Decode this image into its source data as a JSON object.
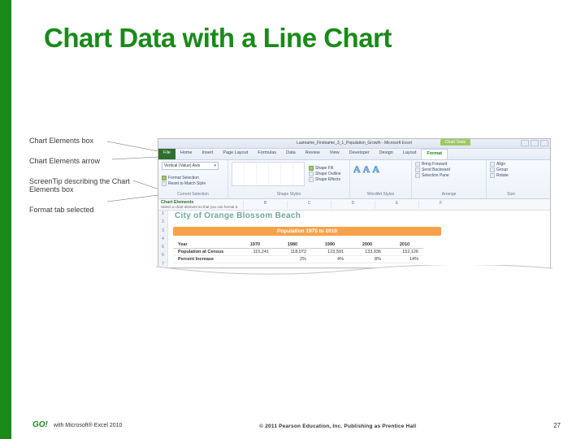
{
  "slide": {
    "title": "Chart Data with a Line Chart",
    "callouts": {
      "c1": "Chart Elements box",
      "c2": "Chart Elements arrow",
      "c3": "ScreenTip describing the Chart Elements box",
      "c4": "Format tab selected"
    }
  },
  "excel": {
    "titlebar": "Lastname_Firstname_3_1_Population_Growth - Microsoft Excel",
    "chart_tools": "Chart Tools",
    "file_tab": "File",
    "tabs": [
      "Home",
      "Insert",
      "Page Layout",
      "Formulas",
      "Data",
      "Review",
      "View",
      "Developer",
      "Design",
      "Layout",
      "Format"
    ],
    "selected_tab": "Format",
    "element_box_value": "Vertical (Value) Axis",
    "format_selection": "Format Selection",
    "reset_style": "Reset to Match Style",
    "group_current": "Current Selection",
    "group_shape_styles": "Shape Styles",
    "group_wordart": "WordArt Styles",
    "group_arrange": "Arrange",
    "group_size": "Size",
    "shape_fill": "Shape Fill",
    "shape_outline": "Shape Outline",
    "shape_effects": "Shape Effects",
    "bring_forward": "Bring Forward",
    "send_backward": "Send Backward",
    "selection_pane": "Selection Pane",
    "align": "Align",
    "group_btn": "Group",
    "rotate": "Rotate",
    "chart_elements_label": "Chart Elements",
    "screen_tip": "Select a chart element so that you can format it.",
    "columns": [
      "B",
      "C",
      "D",
      "E",
      "F"
    ],
    "rows": [
      "1",
      "2",
      "3",
      "4",
      "5",
      "6",
      "7"
    ],
    "sheet_title": "City of Orange Blossom Beach",
    "subtitle": "Population 1970 to 2010"
  },
  "chart_data": {
    "type": "table",
    "title": "Population 1970 to 2010",
    "categories": [
      "1970",
      "1980",
      "1990",
      "2000",
      "2010"
    ],
    "series": [
      {
        "name": "Year",
        "values": [
          "1970",
          "1980",
          "1990",
          "2000",
          "2010"
        ]
      },
      {
        "name": "Population at Census",
        "values": [
          "115,241",
          "118,072",
          "123,591",
          "133,936",
          "152,126"
        ]
      },
      {
        "name": "Percent Increase",
        "values": [
          "",
          "2%",
          "4%",
          "8%",
          "14%"
        ]
      }
    ]
  },
  "footer": {
    "logo": "GO!",
    "left": "with Microsoft® Excel 2010",
    "center": "© 2011 Pearson Education, Inc. Publishing as Prentice Hall",
    "page": "27"
  }
}
